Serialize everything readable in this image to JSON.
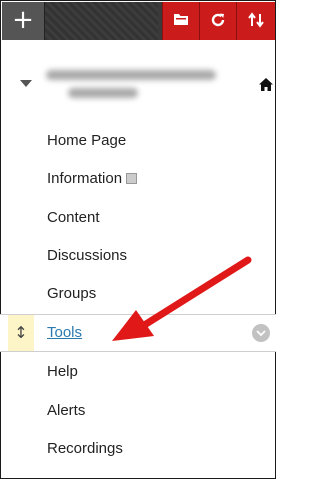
{
  "toolbar": {
    "add_label": "+",
    "buttons": [
      {
        "icon": "folder-icon"
      },
      {
        "icon": "refresh-icon"
      },
      {
        "icon": "sort-icon"
      }
    ],
    "accent_color": "#cc1b1b"
  },
  "course": {
    "title_blurred": true,
    "home_icon": "home-icon"
  },
  "menu": {
    "items": [
      {
        "label": "Home Page"
      },
      {
        "label": "Information"
      },
      {
        "label": "Content"
      },
      {
        "label": "Discussions"
      },
      {
        "label": "Groups"
      },
      {
        "label": "Tools",
        "active": true
      },
      {
        "label": "Help"
      },
      {
        "label": "Alerts"
      },
      {
        "label": "Recordings"
      }
    ]
  },
  "colors": {
    "link": "#2a7ab0",
    "arrow": "#e01818",
    "handle_bg": "#fdf5c8"
  }
}
